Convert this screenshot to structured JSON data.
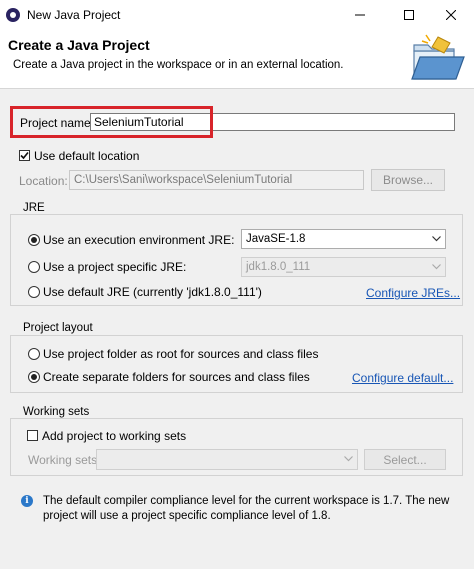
{
  "window": {
    "title": "New Java Project",
    "controls": [
      "minimize",
      "maximize",
      "close"
    ]
  },
  "header": {
    "title": "Create a Java Project",
    "description": "Create a Java project in the workspace or in an external location.",
    "art_icon": "new-java-project-folder-icon"
  },
  "project": {
    "name_label": "Project name:",
    "name_value": "SeleniumTutorial"
  },
  "location": {
    "use_default_label": "Use default location",
    "use_default_checked": true,
    "label": "Location:",
    "value": "C:\\Users\\Sani\\workspace\\SeleniumTutorial",
    "browse_label": "Browse..."
  },
  "jre": {
    "title": "JRE",
    "options": [
      {
        "label": "Use an execution environment JRE:",
        "selected": true,
        "combo_value": "JavaSE-1.8",
        "combo_enabled": true
      },
      {
        "label": "Use a project specific JRE:",
        "selected": false,
        "combo_value": "jdk1.8.0_111",
        "combo_enabled": false
      },
      {
        "label": "Use default JRE (currently 'jdk1.8.0_111')",
        "selected": false
      }
    ],
    "configure_link": "Configure JREs..."
  },
  "layout": {
    "title": "Project layout",
    "options": [
      {
        "label": "Use project folder as root for sources and class files",
        "selected": false
      },
      {
        "label": "Create separate folders for sources and class files",
        "selected": true
      }
    ],
    "configure_link": "Configure default..."
  },
  "working_sets": {
    "title": "Working sets",
    "add_label": "Add project to working sets",
    "add_checked": false,
    "sets_label": "Working sets:",
    "select_label": "Select..."
  },
  "info": {
    "icon": "info-icon",
    "line1": "The default compiler compliance level for the current workspace is 1.7. The new",
    "line2": "project will use a project specific compliance level of 1.8."
  },
  "colors": {
    "highlight": "#d8242a",
    "link": "#1856b5",
    "info_icon": "#2b78c9"
  }
}
